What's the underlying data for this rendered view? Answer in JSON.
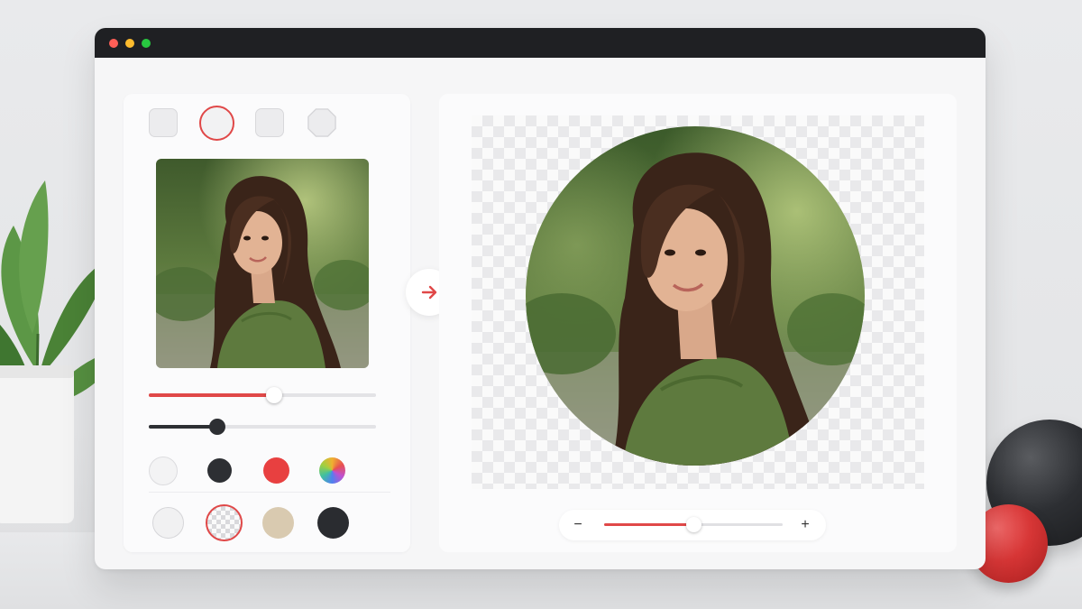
{
  "window": {
    "traffic_lights": {
      "close": "#ff5f57",
      "minimize": "#febc2e",
      "maximize": "#28c840"
    }
  },
  "colors": {
    "accent": "#e04848",
    "dark": "#2d2f33",
    "track": "#e3e3e6"
  },
  "left_panel": {
    "shapes": [
      {
        "name": "square",
        "selected": false
      },
      {
        "name": "circle",
        "selected": true
      },
      {
        "name": "rounded-square",
        "selected": false
      },
      {
        "name": "octagon",
        "selected": false
      }
    ],
    "sliders": [
      {
        "name": "size",
        "level": 0.55,
        "color": "#e04848"
      },
      {
        "name": "border",
        "level": 0.3,
        "color": "#2d2f33"
      }
    ],
    "border_colors": [
      {
        "name": "white",
        "color": "#f3f3f4",
        "selected": false
      },
      {
        "name": "dark",
        "color": "#2d2f33",
        "selected": false
      },
      {
        "name": "red",
        "color": "#e84040",
        "selected": false
      },
      {
        "name": "gradient",
        "color": "conic",
        "selected": false
      }
    ],
    "backgrounds": [
      {
        "name": "white",
        "color": "#f1f1f2",
        "selected": false
      },
      {
        "name": "transparent",
        "color": "checker",
        "selected": true
      },
      {
        "name": "beige",
        "color": "#d9cab0",
        "selected": false
      },
      {
        "name": "dark",
        "color": "#2a2c30",
        "selected": false
      }
    ]
  },
  "preview": {
    "zoom_level": 0.5,
    "zoom_out_label": "−",
    "zoom_in_label": "+"
  }
}
